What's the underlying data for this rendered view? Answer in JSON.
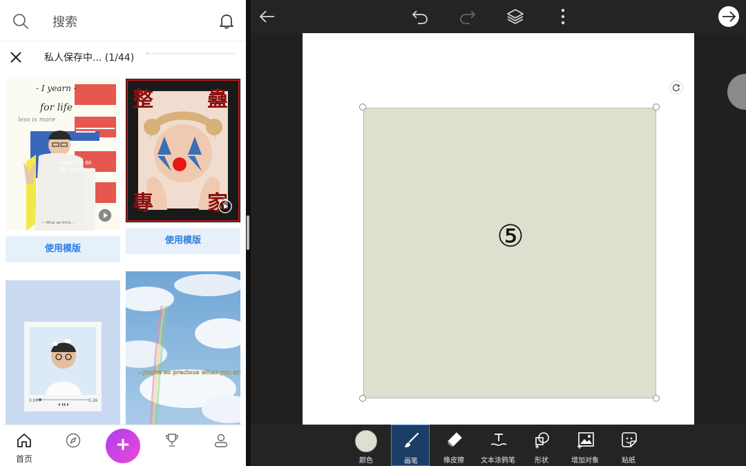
{
  "search": {
    "label": "搜索"
  },
  "private": {
    "title": "私人保存中... (1/44)",
    "progress": 0.0227
  },
  "cards": {
    "c1": {
      "use_label": "使用模版",
      "line1": "- I yearn -",
      "line2": "for life",
      "line3": "less is more",
      "sticker1": "I WANT TO BE",
      "sticker2": "THE ONLY ONE"
    },
    "c2": {
      "use_label": "使用模版",
      "ch1": "整",
      "ch2": "蠱",
      "ch3": "專",
      "ch4": "家"
    },
    "c3": {
      "time_start": "0:00",
      "time_end": "5:26"
    },
    "c4": {
      "caption": "- you're so precious when you smile"
    }
  },
  "nav": {
    "home": "首页"
  },
  "fab_symbol": "+",
  "editor": {
    "shape_label": "⑤",
    "shape_color": "#dfdfd0"
  },
  "tools": {
    "color": "颜色",
    "brush": "画笔",
    "eraser": "橡皮擦",
    "text_brush": "文本涂鸦笔",
    "shape": "形状",
    "add_object": "增加对象",
    "sticker": "贴纸"
  },
  "colors": {
    "accent": "#2f7de1",
    "fab": "#c243e6",
    "active_tool": "#1a3e66"
  }
}
